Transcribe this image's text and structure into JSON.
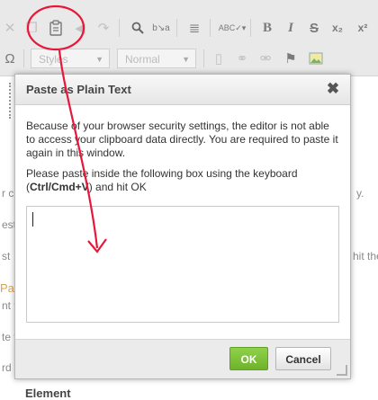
{
  "toolbar": {
    "row1_buttons": [
      {
        "name": "cut-icon",
        "glyph": "✕"
      },
      {
        "name": "copy-icon",
        "glyph": "❐"
      },
      {
        "name": "paste-plain-text-icon",
        "glyph": "▤"
      },
      {
        "name": "undo-icon",
        "glyph": "◀"
      },
      {
        "name": "redo-icon",
        "glyph": "↷"
      },
      {
        "name": "find-icon",
        "glyph": "🔍"
      },
      {
        "name": "replace-icon",
        "glyph": "b→a"
      },
      {
        "name": "select-all-icon",
        "glyph": "≣"
      },
      {
        "name": "spellcheck-icon",
        "glyph": "ABC"
      },
      {
        "name": "bold-icon",
        "glyph": "B"
      },
      {
        "name": "italic-icon",
        "glyph": "I"
      },
      {
        "name": "strike-icon",
        "glyph": "S"
      },
      {
        "name": "subscript-icon",
        "glyph": "x₂"
      },
      {
        "name": "superscript-icon",
        "glyph": "x²"
      }
    ],
    "styles_combo": "Styles",
    "format_combo": "Normal",
    "omega_glyph": "Ω"
  },
  "background_doc": {
    "line_a": "r cu",
    "line_a_right": "y.",
    "line_b": "est",
    "line_c": "st",
    "line_c_right": "hit the",
    "line_d": "Pas",
    "line_e": "nt f",
    "line_f": "te t",
    "line_g": "rd",
    "line_h": "Element"
  },
  "dialog": {
    "title": "Paste as Plain Text",
    "close_glyph": "✖",
    "paragraph1": "Because of your browser security settings, the editor is not able to access your clipboard data directly. You are required to paste it again in this window.",
    "paragraph2_prefix": "Please paste inside the following box using the keyboard (",
    "paragraph2_shortcut": "Ctrl/Cmd+V",
    "paragraph2_suffix": ") and hit OK",
    "textarea_value": "",
    "ok_label": "OK",
    "cancel_label": "Cancel"
  },
  "annotation": {
    "color": "#e8173a"
  }
}
